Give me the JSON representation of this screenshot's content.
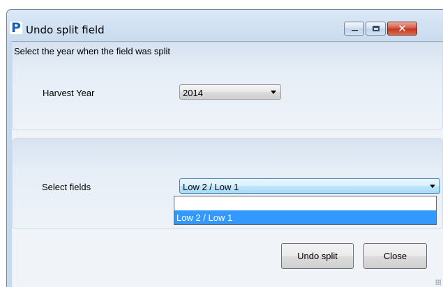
{
  "window": {
    "title": "Undo split field",
    "logo_letter": "P",
    "controls": {
      "minimize": "minimize",
      "maximize": "maximize",
      "close": "✕"
    }
  },
  "instruction": "Select the year when the field was split",
  "harvest_year": {
    "label": "Harvest Year",
    "value": "2014"
  },
  "select_fields": {
    "label": "Select fields",
    "value": "Low 2 / Low 1",
    "dropdown_open": true,
    "options": [
      "",
      "Low 2 / Low 1"
    ],
    "highlighted_option": "Low 2 / Low 1"
  },
  "buttons": {
    "undo_split": "Undo split",
    "close": "Close"
  },
  "colors": {
    "selection": "#3399ff",
    "title_bar": "#c9dbef",
    "close_button": "#c2341c"
  }
}
